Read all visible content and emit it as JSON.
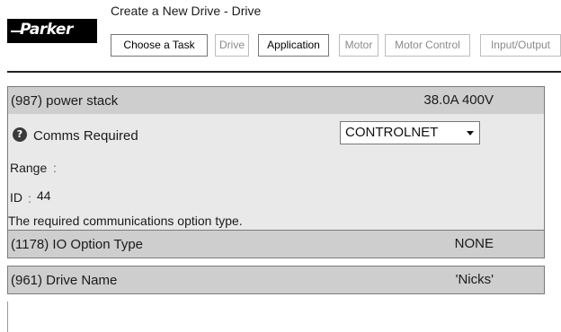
{
  "brand": {
    "logo_text": "Parker"
  },
  "header": {
    "title": "Create a New Drive - Drive"
  },
  "tabs": [
    {
      "label": "Choose a Task",
      "state": "active"
    },
    {
      "label": "Drive",
      "state": "inactive"
    },
    {
      "label": "Application",
      "state": "active"
    },
    {
      "label": "Motor",
      "state": "inactive"
    },
    {
      "label": "Motor Control",
      "state": "inactive"
    },
    {
      "label": "Input/Output",
      "state": "inactive"
    }
  ],
  "parameters": [
    {
      "label": "(987) power stack",
      "value": "38.0A 400V"
    },
    {
      "label": "(1178) IO Option Type",
      "value": "NONE"
    },
    {
      "label": "(961) Drive Name",
      "value": "'Nicks'"
    }
  ],
  "detail": {
    "help_icon": "question-mark-icon",
    "field_label": "Comms Required",
    "dropdown_value": "CONTROLNET",
    "dropdown_arrow": "chevron-down-icon",
    "range_label": "Range",
    "range_sep": ":",
    "id_label": "ID",
    "id_sep": ":",
    "id_value": "44",
    "description": "The required communications option type."
  },
  "colors": {
    "row_background": "#cecece",
    "detail_background": "#e9e9e9",
    "border": "#7a7a7a",
    "inactive_tab_text": "#8a8a8a",
    "logo_background": "#000000"
  }
}
